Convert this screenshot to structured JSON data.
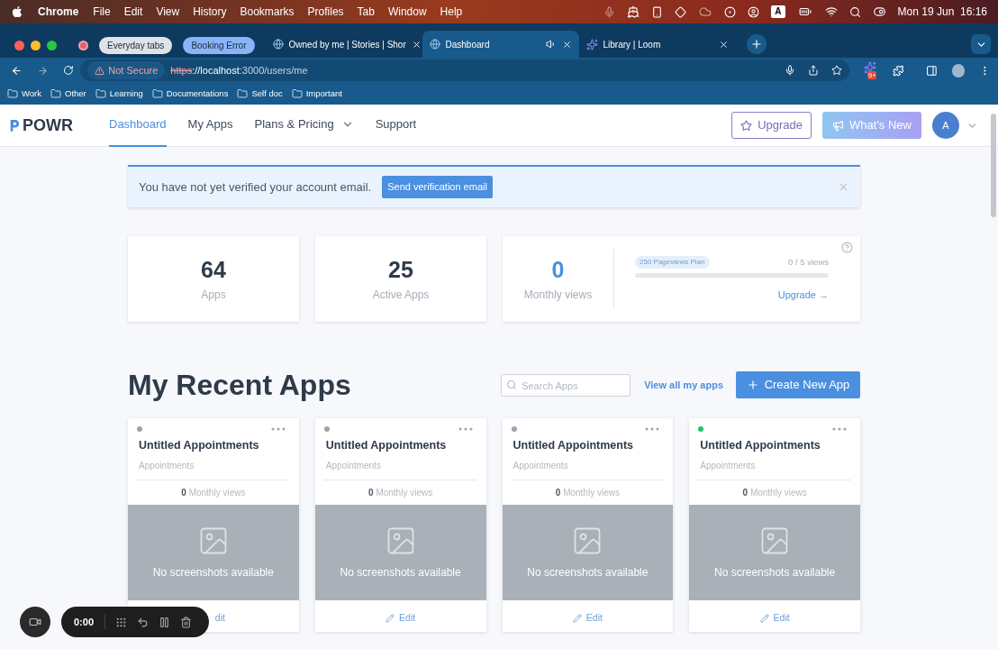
{
  "menubar": {
    "app": "Chrome",
    "menus": [
      "File",
      "Edit",
      "View",
      "History",
      "Bookmarks",
      "Profiles",
      "Tab",
      "Window",
      "Help"
    ],
    "input_source": "A",
    "clock": "Mon 19 Jun  16:16"
  },
  "browser": {
    "tab_groups": [
      {
        "label": "Everyday tabs",
        "color": "#dfe3e8"
      },
      {
        "label": "Booking Error",
        "color": "#8ab4f8"
      }
    ],
    "tabs": [
      {
        "title": "Owned by me | Stories | Shor",
        "selected": false,
        "audio": false
      },
      {
        "title": "Dashboard",
        "selected": true,
        "audio": true
      },
      {
        "title": "Library | Loom",
        "selected": false,
        "audio": false
      }
    ],
    "security": "Not Secure",
    "url_scheme": "https",
    "url_host": "://localhost",
    "url_rest": ":3000/users/me",
    "extension_badge": "9+",
    "bookmarks": [
      "Work",
      "Other",
      "Learning",
      "Documentations",
      "Self doc",
      "Important"
    ]
  },
  "header": {
    "logo": "POWR",
    "nav": [
      {
        "label": "Dashboard",
        "selected": true,
        "dropdown": false
      },
      {
        "label": "My Apps",
        "selected": false,
        "dropdown": false
      },
      {
        "label": "Plans & Pricing",
        "selected": false,
        "dropdown": true
      },
      {
        "label": "Support",
        "selected": false,
        "dropdown": false
      }
    ],
    "upgrade": "Upgrade",
    "whats_new": "What's New",
    "avatar": "A"
  },
  "banner": {
    "message": "You have not yet verified your account email.",
    "action": "Send verification email"
  },
  "stats": [
    {
      "value": "64",
      "label": "Apps"
    },
    {
      "value": "25",
      "label": "Active Apps"
    }
  ],
  "views": {
    "value": "0",
    "label": "Monthly views",
    "plan": "250 Pageviews Plan",
    "usage": "0 / 5 views",
    "level": 0,
    "link": "Upgrade →"
  },
  "recent": {
    "title": "My Recent Apps",
    "search_placeholder": "Search Apps",
    "view_all": "View all my apps",
    "create": "Create New App",
    "apps": [
      {
        "title": "Untitled Appointments",
        "type": "Appointments",
        "views": "0",
        "views_label": "Monthly views",
        "placeholder": "No screenshots available",
        "edit": "dit",
        "edit_icon": false,
        "color": "#9ca3af"
      },
      {
        "title": "Untitled Appointments",
        "type": "Appointments",
        "views": "0",
        "views_label": "Monthly views",
        "placeholder": "No screenshots available",
        "edit": "Edit",
        "edit_icon": true,
        "color": "#9ca3af"
      },
      {
        "title": "Untitled Appointments",
        "type": "Appointments",
        "views": "0",
        "views_label": "Monthly views",
        "placeholder": "No screenshots available",
        "edit": "Edit",
        "edit_icon": true,
        "color": "#9ca3af"
      },
      {
        "title": "Untitled Appointments",
        "type": "Appointments",
        "views": "0",
        "views_label": "Monthly views",
        "placeholder": "No screenshots available",
        "edit": "Edit",
        "edit_icon": true,
        "color": "#22c55e"
      }
    ]
  },
  "recorder": {
    "time": "0:00"
  }
}
